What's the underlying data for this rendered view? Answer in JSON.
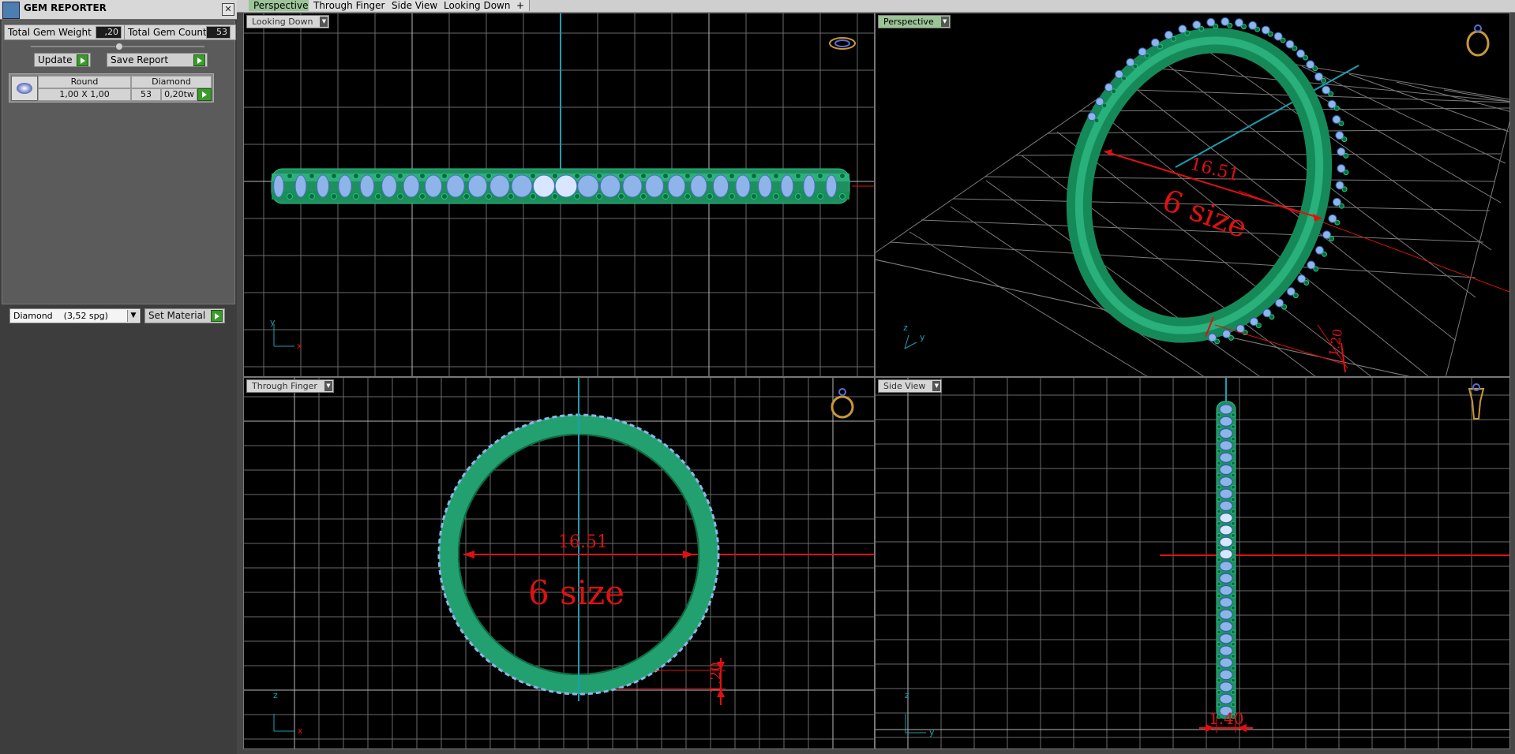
{
  "gem_reporter": {
    "title": "GEM REPORTER",
    "close": "✕",
    "total_weight_label": "Total Gem Weight",
    "total_weight_value": ",20",
    "total_count_label": "Total Gem Count",
    "total_count_value": "53",
    "update_label": "Update",
    "save_report_label": "Save Report",
    "table": {
      "headers": [
        "Round",
        "Diamond"
      ],
      "size": "1,00 X 1,00",
      "count": "53",
      "weight": "0,20tw"
    },
    "material_select": "Diamond    (3,52 spg)",
    "set_material_label": "Set Material"
  },
  "tabs": [
    "Perspective",
    "Through Finger",
    "Side View",
    "Looking Down",
    "+"
  ],
  "viewports": {
    "looking_down": {
      "label": "Looking Down",
      "axis_v": "y",
      "axis_h": "x"
    },
    "perspective": {
      "label": "Perspective",
      "dim_diameter": "16.51",
      "size_text": "6 size",
      "dim_width": "1.20",
      "axis_v": "z",
      "axis_h": "y"
    },
    "through_finger": {
      "label": "Through Finger",
      "dim_diameter": "16.51",
      "size_text": "6 size",
      "dim_thickness": "1.20",
      "axis_v": "z",
      "axis_h": "x"
    },
    "side_view": {
      "label": "Side View",
      "dim_width": "1.40",
      "axis_v": "z",
      "axis_h": "y"
    }
  },
  "colors": {
    "ring_green": "#22a070",
    "gem_blue": "#8fb4ea",
    "dim_red": "#e01010",
    "axis_cyan": "#1b9fb0",
    "grid": "#9a9a9a"
  }
}
